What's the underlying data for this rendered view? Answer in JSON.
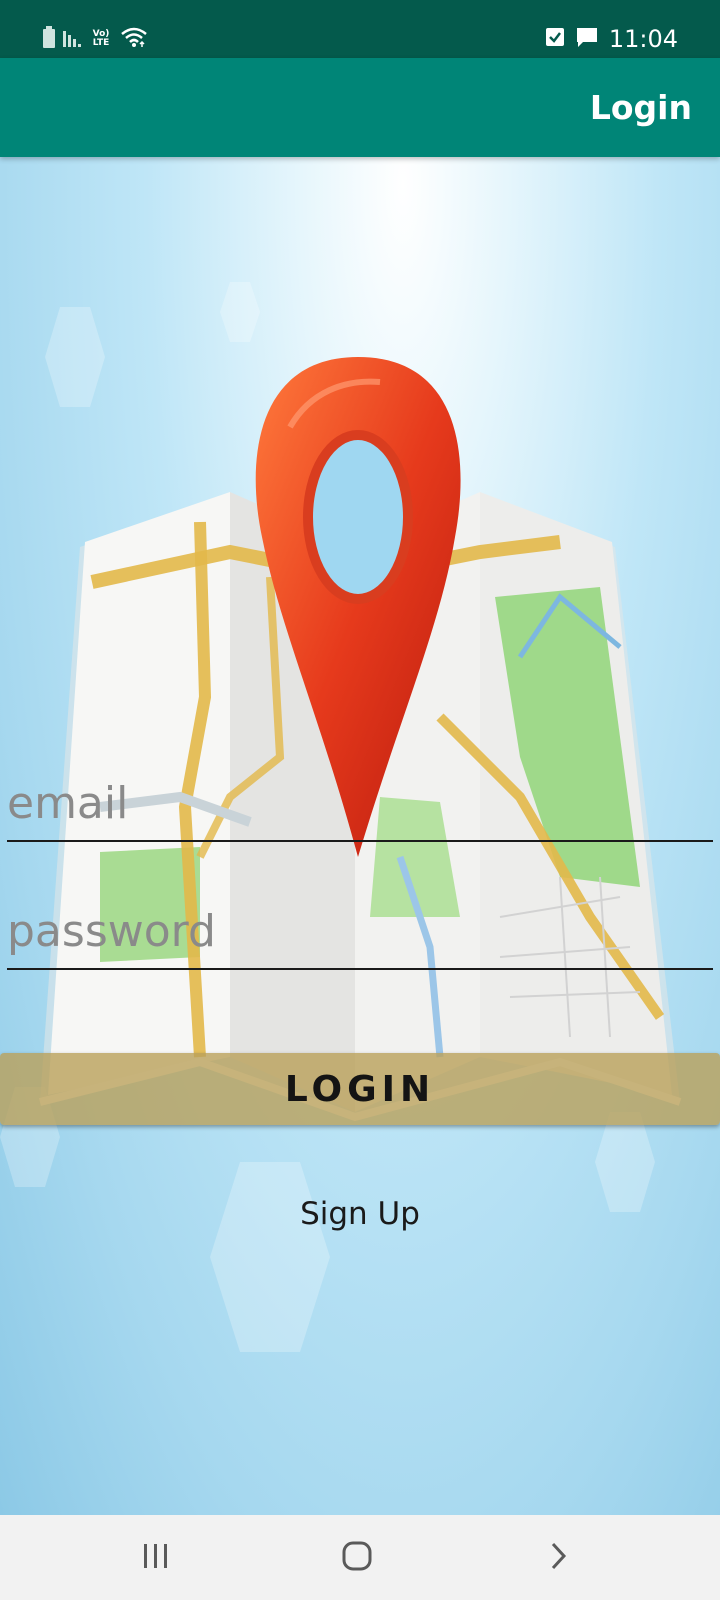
{
  "status_bar": {
    "network_label": "Vo) LTE",
    "time": "11:04",
    "icons": [
      "battery-icon",
      "signal-icon",
      "volte-icon",
      "wifi-icon",
      "checkbox-notification-icon",
      "message-notification-icon"
    ]
  },
  "app_bar": {
    "title": "Login",
    "color": "#008577"
  },
  "form": {
    "email_placeholder": "email",
    "email_value": "",
    "password_placeholder": "password",
    "password_value": "",
    "login_label": "LOGIN",
    "signup_label": "Sign Up"
  },
  "nav_bar": {
    "icons": [
      "recent-apps-icon",
      "home-icon",
      "back-icon"
    ]
  },
  "colors": {
    "status_bar": "#045a4c",
    "accent": "#008577",
    "login_button": "#b9a05a",
    "pin": "#e63a1c"
  }
}
